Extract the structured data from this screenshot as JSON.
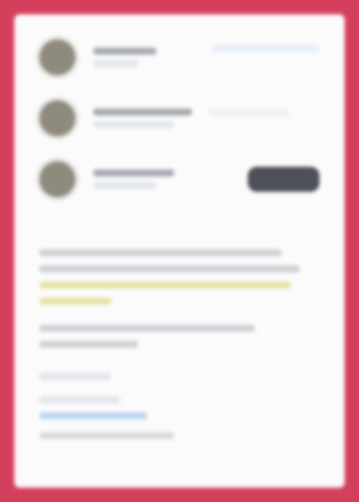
{
  "items": [
    {
      "name": "",
      "meta": ""
    },
    {
      "name": "",
      "meta": ""
    },
    {
      "name": "",
      "meta": "",
      "action_label": ""
    }
  ],
  "body": {
    "paragraph_1": "",
    "paragraph_2": "",
    "paragraph_3": "",
    "link_label": "",
    "footer_text": ""
  },
  "colors": {
    "frame_border": "#d4405c",
    "panel_bg": "#fbfbfc",
    "avatar_bg": "#8f8b7c",
    "button_bg": "#4d5058",
    "link_blue": "#bcd7f0",
    "highlight_yellow": "#e7e3a7"
  }
}
